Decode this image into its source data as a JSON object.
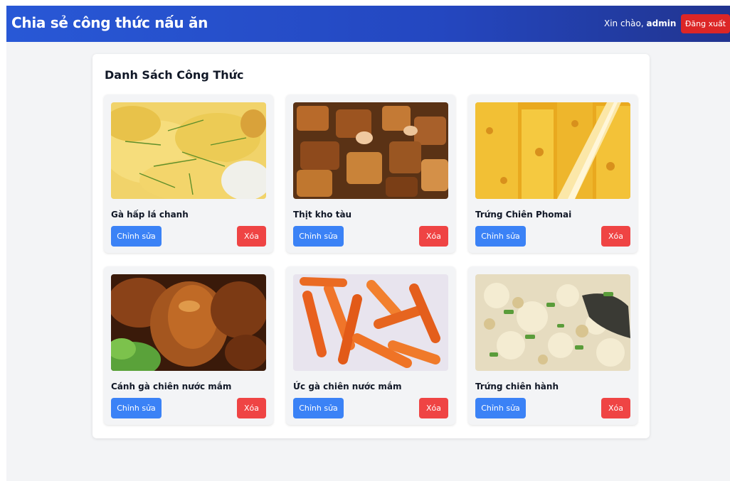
{
  "header": {
    "brand": "Chia sẻ công thức nấu ăn",
    "greeting_prefix": "Xin chào, ",
    "username": "admin",
    "logout_label": "Đăng xuất"
  },
  "main": {
    "title": "Danh Sách Công Thức",
    "recipes": [
      {
        "name": "Gà hấp lá chanh",
        "edit_label": "Chỉnh sửa",
        "delete_label": "Xóa"
      },
      {
        "name": "Thịt kho tàu",
        "edit_label": "Chỉnh sửa",
        "delete_label": "Xóa"
      },
      {
        "name": "Trứng Chiên Phomai",
        "edit_label": "Chỉnh sửa",
        "delete_label": "Xóa"
      },
      {
        "name": "Cánh gà chiên nước mắm",
        "edit_label": "Chỉnh sửa",
        "delete_label": "Xóa"
      },
      {
        "name": "Ức gà chiên nước mắm",
        "edit_label": "Chỉnh sửa",
        "delete_label": "Xóa"
      },
      {
        "name": "Trứng chiên hành",
        "edit_label": "Chỉnh sửa",
        "delete_label": "Xóa"
      }
    ]
  },
  "colors": {
    "header_gradient_start": "#2858d6",
    "header_gradient_end": "#21348f",
    "edit_button": "#3b82f6",
    "delete_button": "#ef4444",
    "logout_button": "#dc2626",
    "page_background": "#f3f4f6"
  }
}
